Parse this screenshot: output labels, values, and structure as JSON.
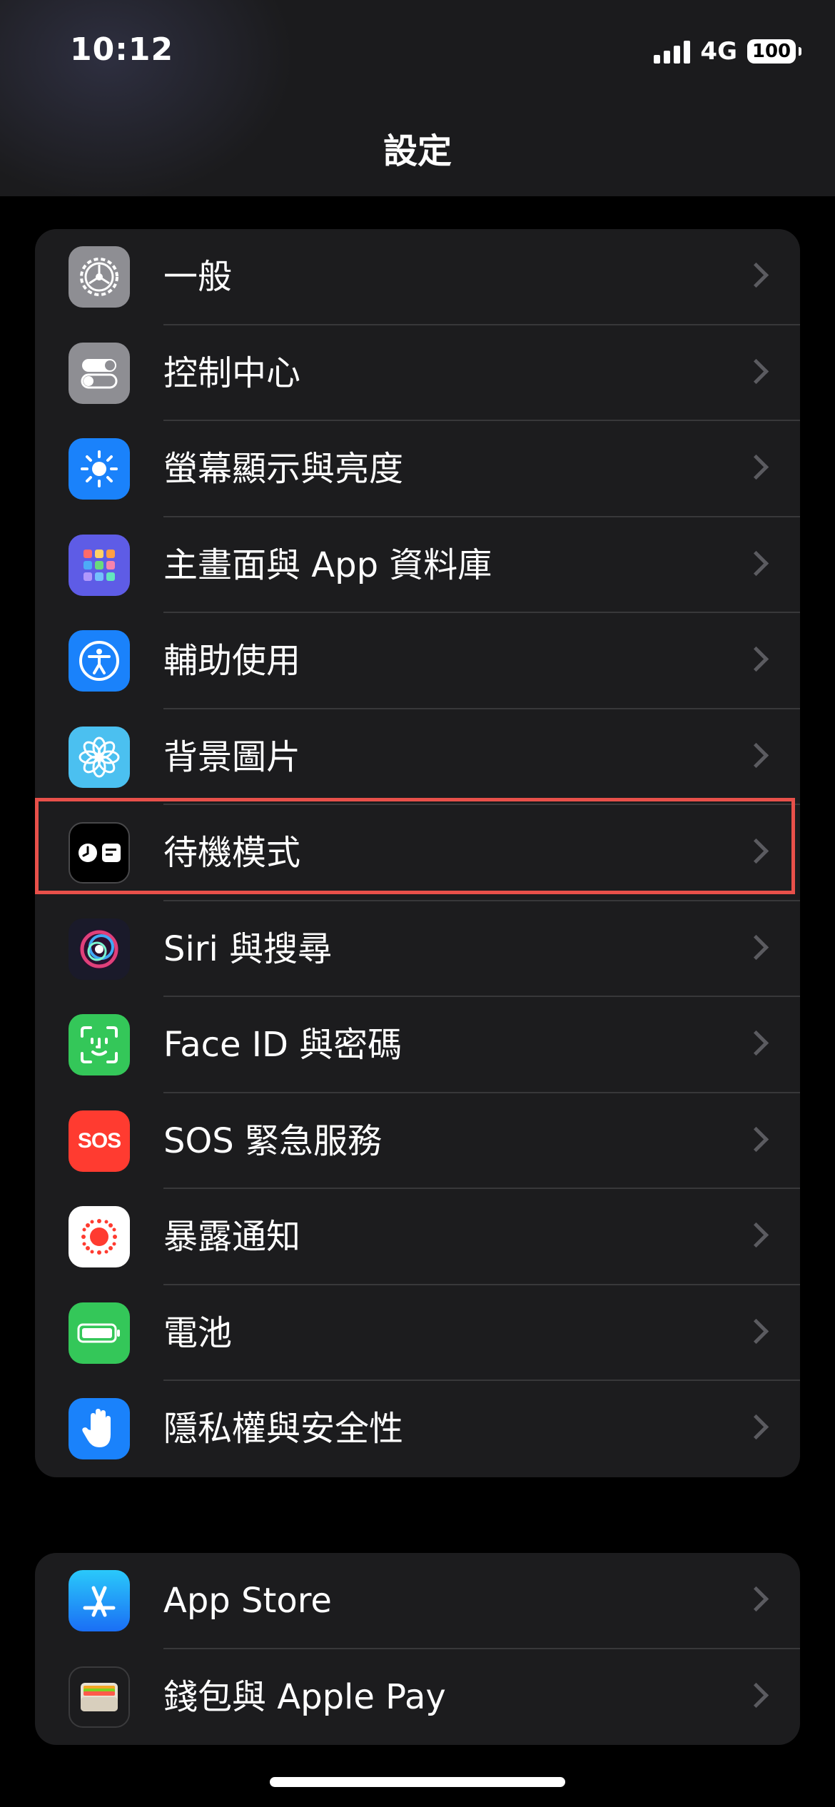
{
  "status_bar": {
    "time": "10:12",
    "network": "4G",
    "battery": "100"
  },
  "header": {
    "title": "設定"
  },
  "groups": [
    {
      "items": [
        {
          "label": "一般",
          "icon": "gear-icon",
          "color": "#8e8e93"
        },
        {
          "label": "控制中心",
          "icon": "toggles-icon",
          "color": "#8e8e93"
        },
        {
          "label": "螢幕顯示與亮度",
          "icon": "sun-icon",
          "color": "#1a82fb"
        },
        {
          "label": "主畫面與 App 資料庫",
          "icon": "app-grid-icon",
          "color": "#5e5ce6"
        },
        {
          "label": "輔助使用",
          "icon": "accessibility-icon",
          "color": "#1a82fb"
        },
        {
          "label": "背景圖片",
          "icon": "flower-icon",
          "color": "#4bc0f0"
        },
        {
          "label": "待機模式",
          "icon": "standby-icon",
          "color": "#000000",
          "highlighted": true
        },
        {
          "label": "Siri 與搜尋",
          "icon": "siri-icon",
          "color": "#1a1a2a"
        },
        {
          "label": "Face ID 與密碼",
          "icon": "face-id-icon",
          "color": "#34c759"
        },
        {
          "label": "SOS 緊急服務",
          "icon": "sos-icon",
          "color": "#ff3b30",
          "icon_text": "SOS"
        },
        {
          "label": "暴露通知",
          "icon": "exposure-icon",
          "color": "#ffffff"
        },
        {
          "label": "電池",
          "icon": "battery-icon",
          "color": "#34c759"
        },
        {
          "label": "隱私權與安全性",
          "icon": "hand-icon",
          "color": "#1a82fb"
        }
      ]
    },
    {
      "items": [
        {
          "label": "App Store",
          "icon": "app-store-icon",
          "color": "#1a82fb"
        },
        {
          "label": "錢包與 Apple Pay",
          "icon": "wallet-icon",
          "color": "#1c1c1e"
        }
      ]
    }
  ],
  "highlight_color": "#e8504a"
}
